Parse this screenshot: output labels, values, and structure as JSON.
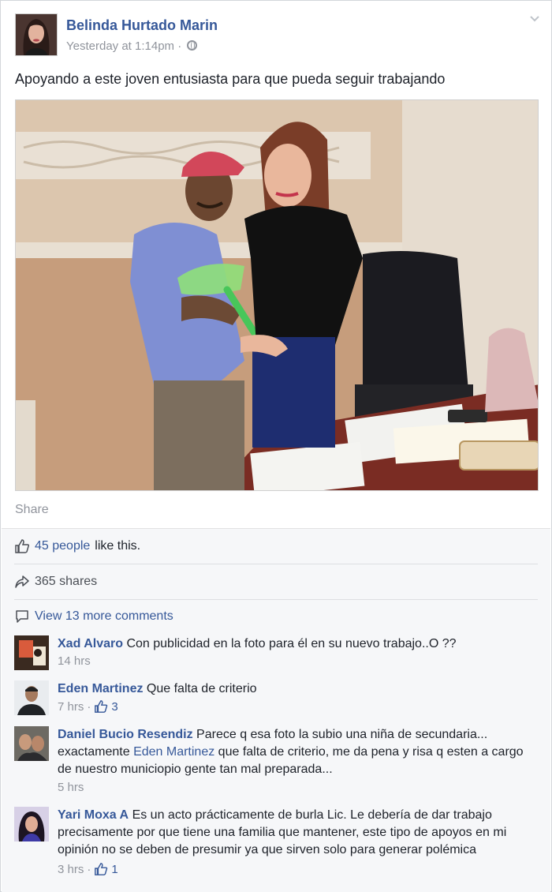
{
  "post": {
    "author": "Belinda Hurtado Marin",
    "timestamp": "Yesterday at 1:14pm",
    "separator": " · ",
    "privacy_icon": "globe-icon",
    "text": "Apoyando a este joven entusiasta para que pueda seguir trabajando",
    "share_label": "Share"
  },
  "stats": {
    "likes_count": "45 people",
    "likes_suffix": "like this.",
    "shares": "365 shares",
    "view_more": "View 13 more comments"
  },
  "comments": [
    {
      "author": "Xad Alvaro",
      "text": "Con publicidad en la foto para él en su nuevo trabajo..O ??",
      "time": "14 hrs",
      "likes": ""
    },
    {
      "author": "Eden Martinez",
      "text": "Que falta de criterio",
      "time": "7 hrs",
      "likes": "3"
    },
    {
      "author": "Daniel Bucio Resendiz",
      "text_before": "Parece q esa foto la subio una niña de secundaria... exactamente ",
      "mention": "Eden Martinez",
      "text_after": " que falta de criterio, me da pena y risa q esten a cargo de nuestro municiopio gente tan mal preparada...",
      "time": "5 hrs",
      "likes": ""
    },
    {
      "author": "Yari Moxa A",
      "text": "Es un acto prácticamente de burla Lic. Le debería de dar trabajo precisamente por que tiene una familia que mantener, este tipo de apoyos en mi opinión no se deben de presumir ya que sirven solo para generar polémica",
      "time": "3 hrs",
      "likes": "1"
    }
  ],
  "colors": {
    "link": "#365899",
    "meta": "#90949c",
    "footer_bg": "#f6f7f9"
  }
}
